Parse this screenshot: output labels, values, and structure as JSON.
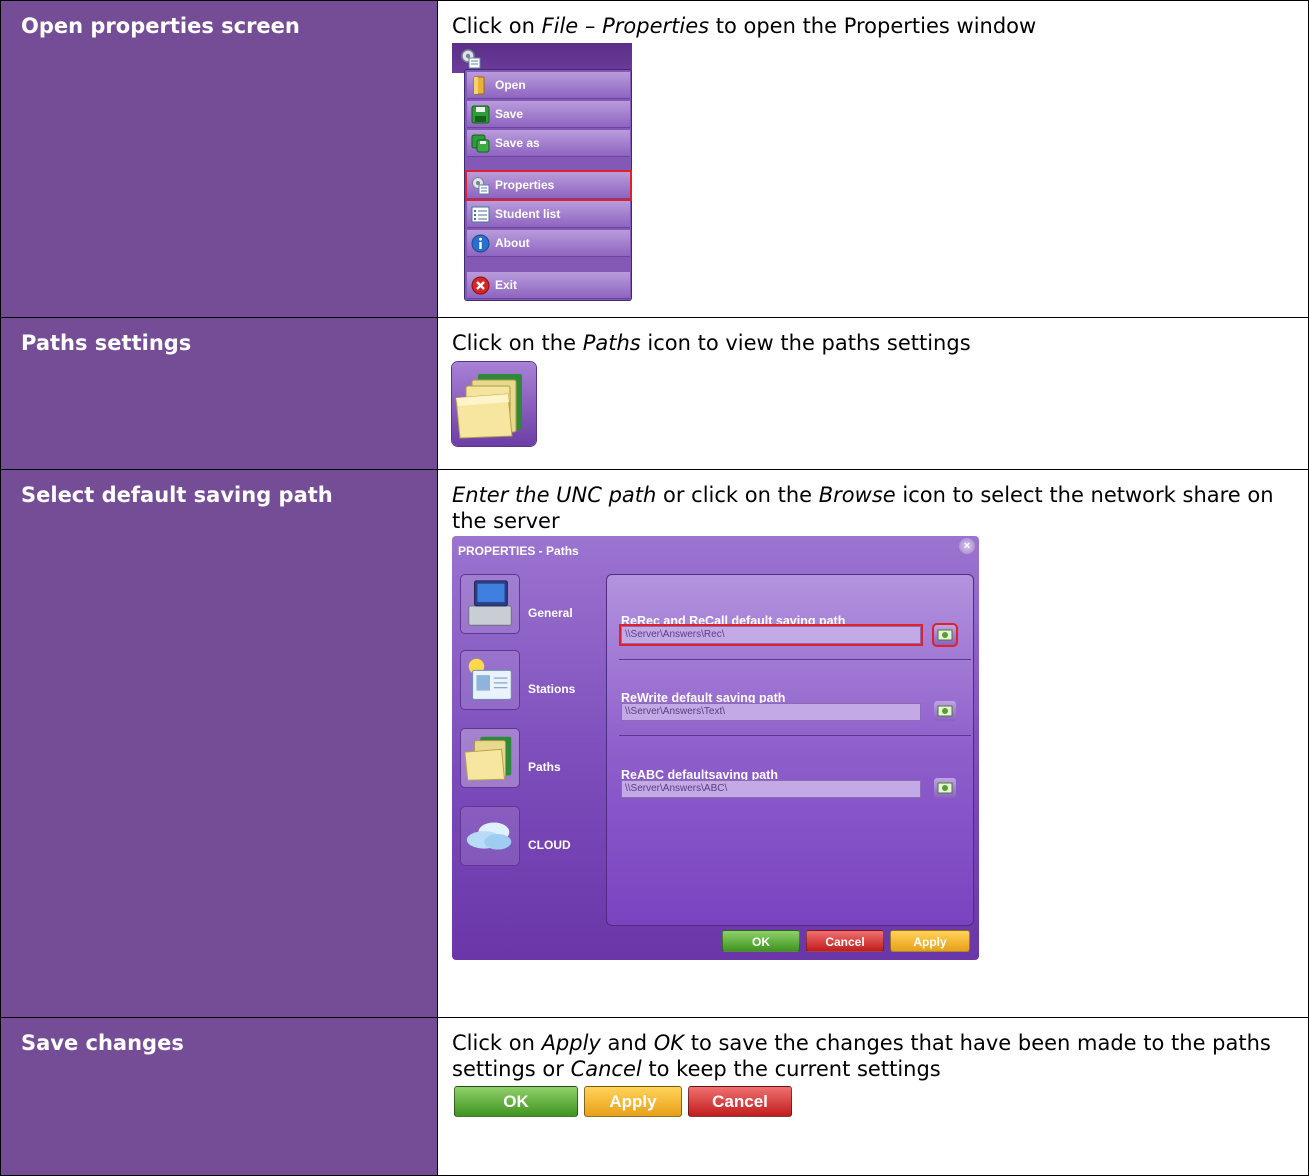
{
  "rows": [
    {
      "label": "Open properties screen",
      "text_1": "Click on ",
      "text_em_1": "File",
      "text_2": " – ",
      "text_em_2": "Properties",
      "text_3": " to open the Properties window"
    },
    {
      "label": "Paths settings",
      "text_1": "Click on the ",
      "text_em_1": "Paths",
      "text_2": " icon to view the paths settings"
    },
    {
      "label": "Select default saving path",
      "text_em_1": "Enter the UNC path",
      "text_1": " or click on the ",
      "text_em_2": "Browse",
      "text_2": " icon to select the network share on the server"
    },
    {
      "label": "Save changes",
      "text_1": "Click on ",
      "text_em_1": "Apply",
      "text_2": " and ",
      "text_em_2": "OK",
      "text_3": " to save the changes that have been made to the paths settings or ",
      "text_em_3": "Cancel",
      "text_4": " to keep the current settings"
    }
  ],
  "file_menu": {
    "items": [
      "Open",
      "Save",
      "Save as",
      "Properties",
      "Student list",
      "About",
      "Exit"
    ],
    "selected": "Properties"
  },
  "properties_window": {
    "title": "PROPERTIES - Paths",
    "close": "×",
    "sidebar": [
      "General",
      "Stations",
      "Paths",
      "CLOUD"
    ],
    "active_tab": "Paths",
    "paths": [
      {
        "label": "ReRec and ReCall default saving path",
        "value": "\\\\Server\\Answers\\Rec\\"
      },
      {
        "label": "ReWrite default saving path",
        "value": "\\\\Server\\Answers\\Text\\"
      },
      {
        "label": "ReABC defaultsaving path",
        "value": "\\\\Server\\Answers\\ABC\\"
      }
    ],
    "buttons": {
      "ok": "OK",
      "cancel": "Cancel",
      "apply": "Apply"
    }
  },
  "save_buttons": {
    "ok": "OK",
    "apply": "Apply",
    "cancel": "Cancel"
  },
  "colors": {
    "label_bg": "#754c96",
    "highlight": "#e0202a",
    "ok": "#4f9e2a",
    "cancel": "#c92424",
    "apply": "#f0b030"
  }
}
